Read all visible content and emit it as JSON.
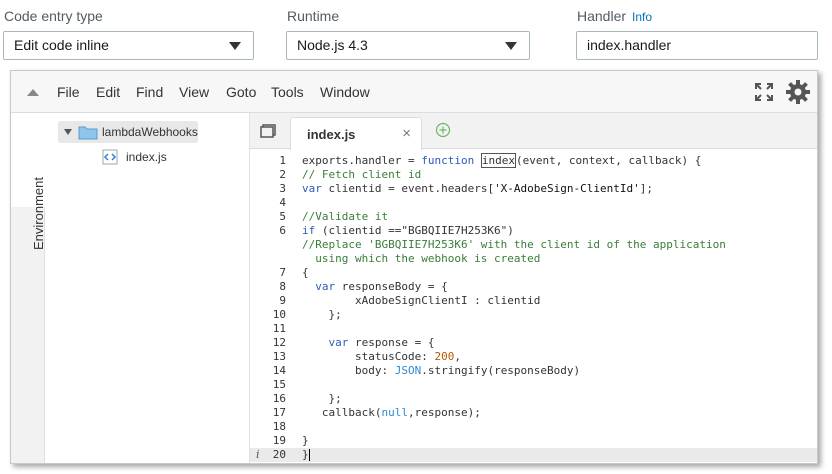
{
  "form": {
    "code_entry": {
      "label": "Code entry type",
      "value": "Edit code inline"
    },
    "runtime": {
      "label": "Runtime",
      "value": "Node.js 4.3"
    },
    "handler": {
      "label": "Handler",
      "info": "Info",
      "value": "index.handler"
    }
  },
  "menu": {
    "items": [
      "File",
      "Edit",
      "Find",
      "View",
      "Goto",
      "Tools",
      "Window"
    ]
  },
  "sidebar": {
    "tab_label": "Environment"
  },
  "tree": {
    "folder": "lambdaWebhooks",
    "file": "index.js"
  },
  "editor": {
    "tab_label": "index.js",
    "tab_close": "×",
    "info_glyph": "i",
    "lines": [
      {
        "n": "1",
        "text": "exports.handler = function index(event, context, callback) {"
      },
      {
        "n": "2",
        "text": "// Fetch client id"
      },
      {
        "n": "3",
        "text": "var clientid = event.headers['X-AdobeSign-ClientId'];"
      },
      {
        "n": "4",
        "text": ""
      },
      {
        "n": "5",
        "text": "//Validate it"
      },
      {
        "n": "6",
        "text": "if (clientid ==\"BGBQIIE7H253K6\")"
      },
      {
        "n": "",
        "text": "//Replace 'BGBQIIE7H253K6' with the client id of the application"
      },
      {
        "n": "",
        "text": "  using which the webhook is created"
      },
      {
        "n": "7",
        "text": "{"
      },
      {
        "n": "8",
        "text": "  var responseBody = {"
      },
      {
        "n": "9",
        "text": "        xAdobeSignClientI : clientid"
      },
      {
        "n": "10",
        "text": "    };"
      },
      {
        "n": "11",
        "text": ""
      },
      {
        "n": "12",
        "text": "    var response = {"
      },
      {
        "n": "13",
        "text": "        statusCode: 200,"
      },
      {
        "n": "14",
        "text": "        body: JSON.stringify(responseBody)"
      },
      {
        "n": "15",
        "text": ""
      },
      {
        "n": "16",
        "text": "    };"
      },
      {
        "n": "17",
        "text": "   callback(null,response);"
      },
      {
        "n": "18",
        "text": ""
      },
      {
        "n": "19",
        "text": "}"
      },
      {
        "n": "20",
        "text": "}"
      }
    ]
  }
}
